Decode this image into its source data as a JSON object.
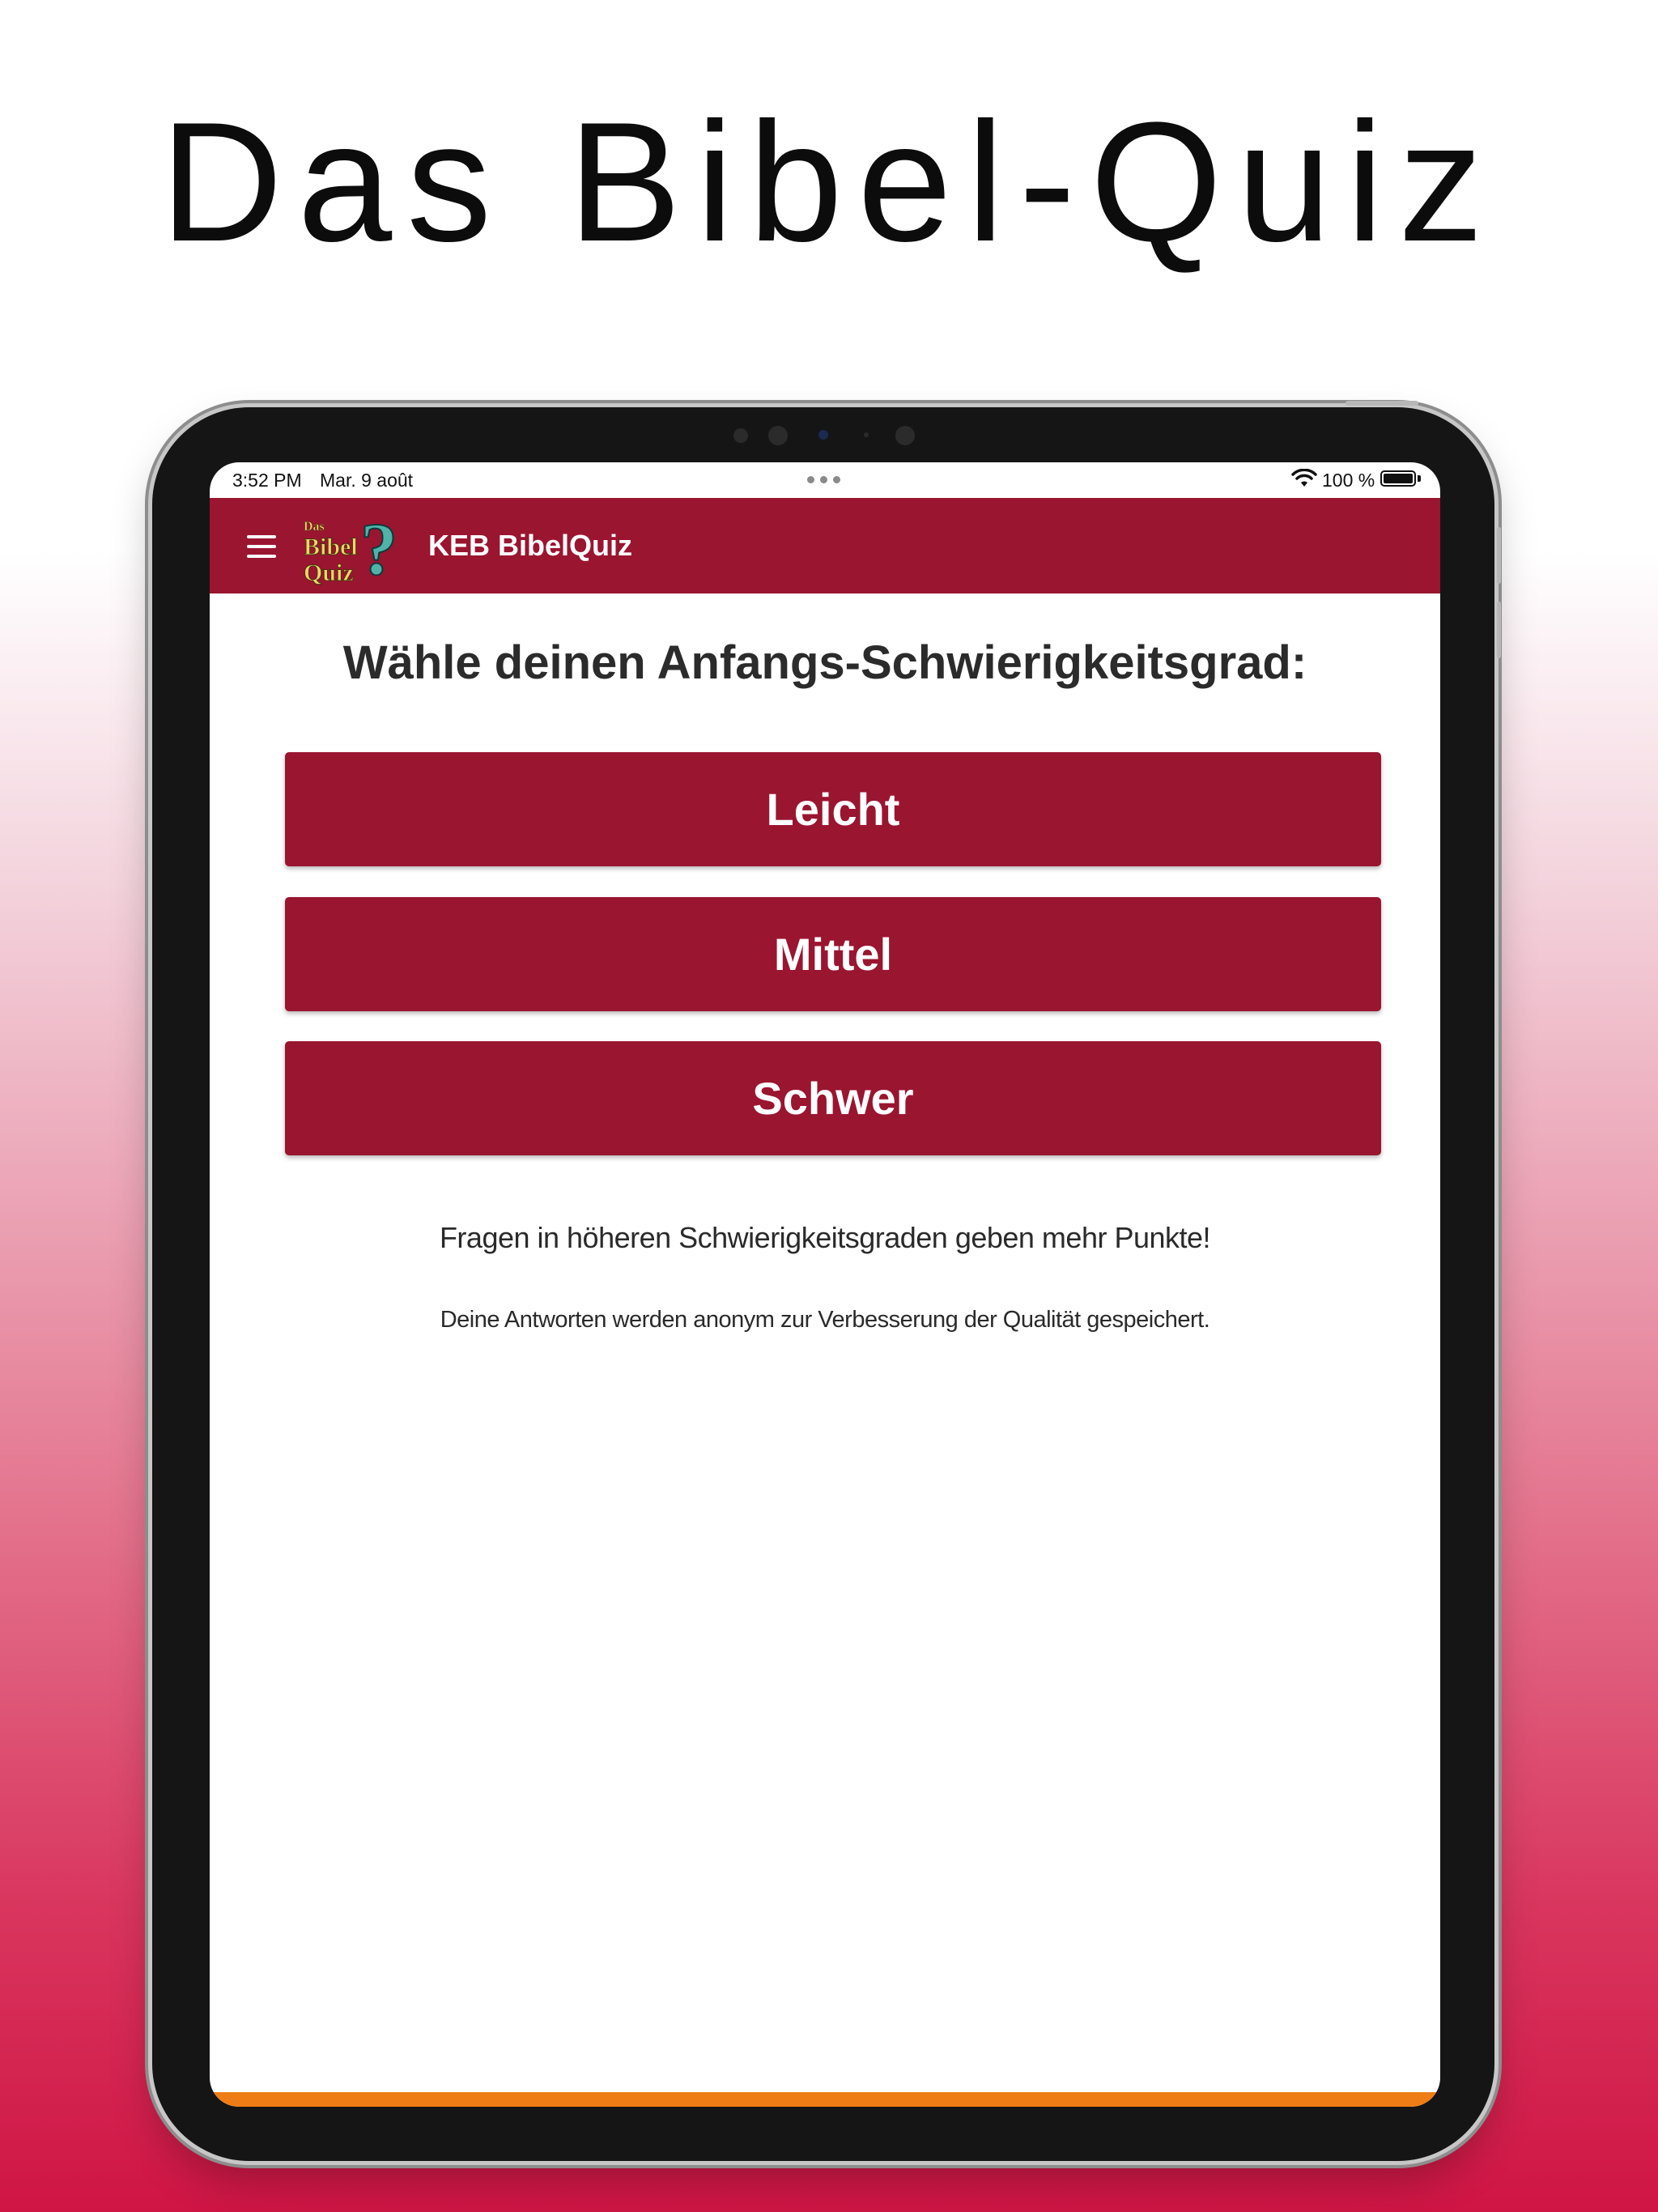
{
  "promo": {
    "title": "Das Bibel-Quiz"
  },
  "status_bar": {
    "time": "3:52 PM",
    "date": "Mar. 9 août",
    "battery": "100 %",
    "icons": [
      "wifi-icon",
      "battery-icon"
    ]
  },
  "app_bar": {
    "menu_icon": "hamburger-menu-icon",
    "logo": {
      "line1": "Das",
      "line2": "Bibel",
      "line3": "Quiz",
      "symbol": "?"
    },
    "title": "KEB BibelQuiz"
  },
  "main": {
    "heading": "Wähle deinen Anfangs-Schwierigkeitsgrad:",
    "buttons": [
      {
        "label": "Leicht"
      },
      {
        "label": "Mittel"
      },
      {
        "label": "Schwer"
      }
    ],
    "note_points": "Fragen in höheren Schwierigkeitsgraden geben mehr Punkte!",
    "note_privacy": "Deine Antworten werden anonym zur Verbesserung der Qualität gespeichert."
  },
  "colors": {
    "brand": "#9a1530",
    "accent_bottom": "#ef7d16",
    "heading_text": "#2b2b2b",
    "background_bottom": "#cf1544"
  }
}
